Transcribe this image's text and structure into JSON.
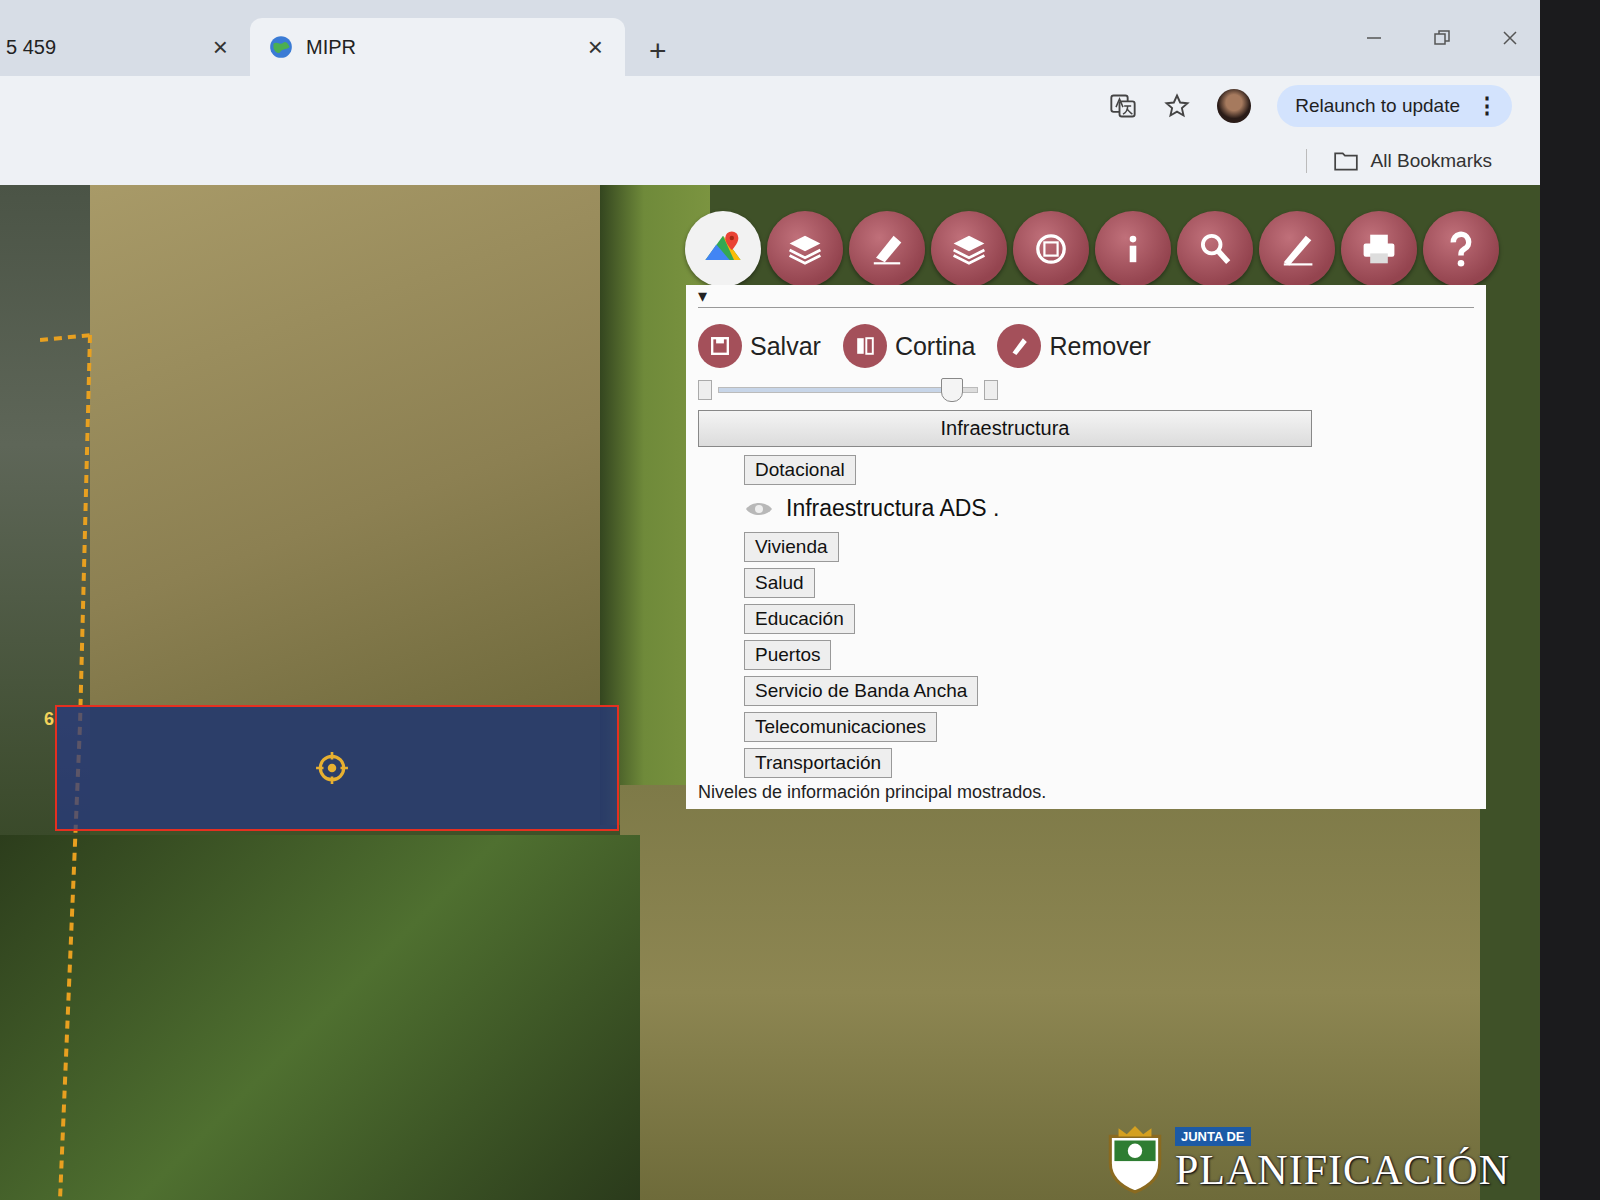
{
  "browser": {
    "tabs": [
      {
        "label": "5 459",
        "selected": false,
        "close": "×"
      },
      {
        "label": "MIPR",
        "selected": true,
        "close": "×"
      }
    ],
    "new_tab": "+",
    "relaunch": "Relaunch to update",
    "menu": "⋮",
    "bookmarks": "All Bookmarks"
  },
  "map": {
    "parcel_label": "6"
  },
  "panel": {
    "collapse": "▾",
    "actions": [
      "Salvar",
      "Cortina",
      "Remover"
    ],
    "opacity": {
      "level": 0.9
    },
    "group": "Infraestructura",
    "layers": [
      {
        "label": "Dotacional",
        "kind": "button"
      },
      {
        "label": "Infraestructura ADS .",
        "kind": "group"
      },
      {
        "label": "Vivienda",
        "kind": "button"
      },
      {
        "label": "Salud",
        "kind": "button"
      },
      {
        "label": "Educación",
        "kind": "button"
      },
      {
        "label": "Puertos",
        "kind": "button"
      },
      {
        "label": "Servicio de Banda Ancha",
        "kind": "button"
      },
      {
        "label": "Telecomunicaciones",
        "kind": "button"
      },
      {
        "label": "Transportación",
        "kind": "button"
      }
    ],
    "status": "Niveles de información principal mostrados."
  },
  "logo": {
    "top": "JUNTA DE",
    "name": "PLANIFICACIÓN"
  }
}
